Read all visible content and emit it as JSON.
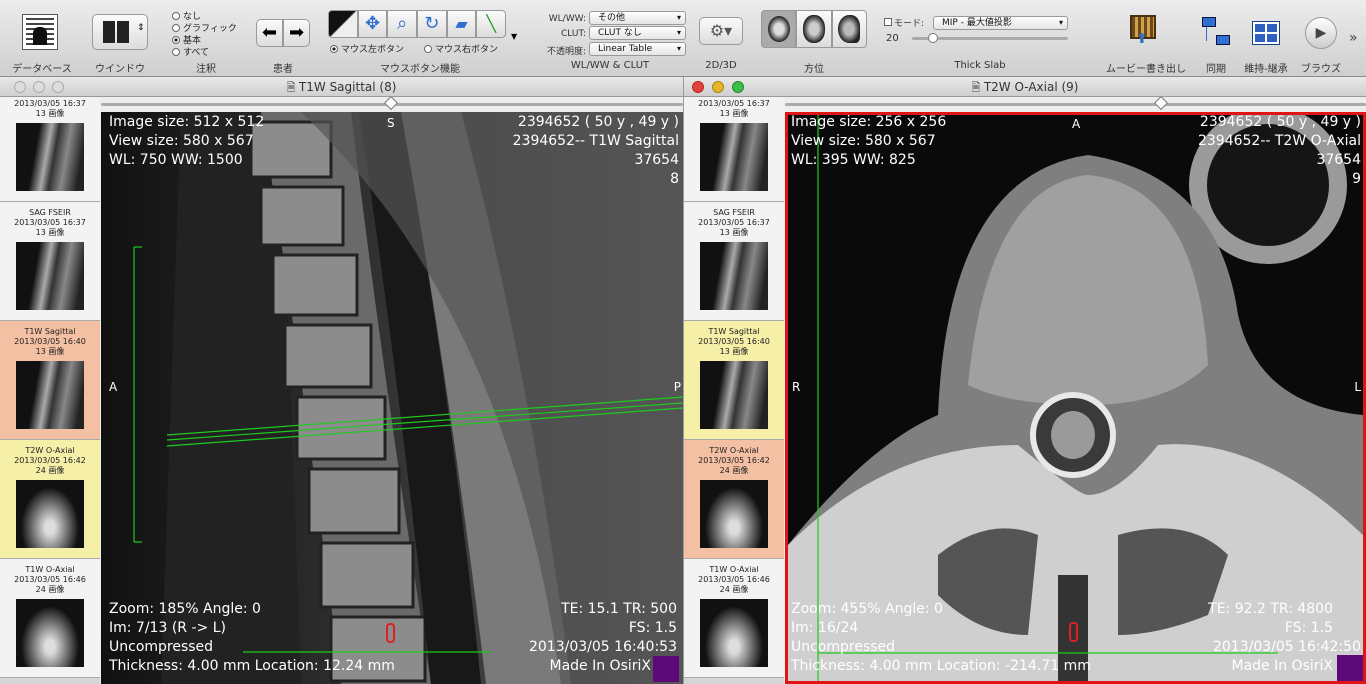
{
  "toolbar": {
    "database": "データベース",
    "window": "ウインドウ",
    "annotation": "注釈",
    "patient": "患者",
    "mouse_func": "マウスボタン機能",
    "wlww_clut": "WL/WW & CLUT",
    "d23": "2D/3D",
    "orientation": "方位",
    "thick_slab": "Thick Slab",
    "movie": "ムービー書き出し",
    "sync": "同期",
    "keep": "維持-継承",
    "browse": "ブラウズ",
    "annot_options": [
      "なし",
      "グラフィック",
      "基本",
      "すべて"
    ],
    "annot_selected": "基本",
    "mouse_left": "マウス左ボタン",
    "mouse_right": "マウス右ボタン",
    "wlww_label": "WL/WW:",
    "wlww_value": "その他",
    "clut_label": "CLUT:",
    "clut_value": "CLUT なし",
    "opacity_label": "不透明度:",
    "opacity_value": "Linear Table",
    "mode_label": "モード:",
    "mode_value": "MIP - 最大値投影",
    "slab_value": "20",
    "accent": "#2f6fd0"
  },
  "left": {
    "title": "T1W Sagittal (8)",
    "series": [
      {
        "name": "",
        "date": "2013/03/05 16:37",
        "count": "13 画像",
        "state": "normal"
      },
      {
        "name": "SAG FSEIR",
        "date": "2013/03/05 16:37",
        "count": "13 画像",
        "state": "normal"
      },
      {
        "name": "T1W Sagittal",
        "date": "2013/03/05 16:40",
        "count": "13 画像",
        "state": "active"
      },
      {
        "name": "T2W O-Axial",
        "date": "2013/03/05 16:42",
        "count": "24 画像",
        "state": "linked"
      },
      {
        "name": "T1W O-Axial",
        "date": "2013/03/05 16:46",
        "count": "24 画像",
        "state": "normal"
      }
    ],
    "ov": {
      "img": "Image size: 512 x 512",
      "view": "View size: 580 x 567",
      "wl": "WL: 750 WW: 1500",
      "pid": "2394652 ( 50 y , 49 y )",
      "pid2": "2394652-- T1W Sagittal",
      "num": "37654",
      "ser": "8",
      "top": "S",
      "left": "A",
      "right": "P",
      "zoom": "Zoom: 185% Angle: 0",
      "im": "Im: 7/13 (R -> L)",
      "comp": "Uncompressed",
      "thick": "Thickness: 4.00 mm Location: 12.24 mm",
      "te": "TE: 15.1 TR: 500",
      "fs": "FS: 1.5",
      "date": "2013/03/05 16:40:53",
      "made": "Made In OsiriX"
    }
  },
  "right": {
    "title": "T2W O-Axial (9)",
    "series": [
      {
        "name": "",
        "date": "2013/03/05 16:37",
        "count": "13 画像",
        "state": "normal"
      },
      {
        "name": "SAG FSEIR",
        "date": "2013/03/05 16:37",
        "count": "13 画像",
        "state": "normal"
      },
      {
        "name": "T1W Sagittal",
        "date": "2013/03/05 16:40",
        "count": "13 画像",
        "state": "linked"
      },
      {
        "name": "T2W O-Axial",
        "date": "2013/03/05 16:42",
        "count": "24 画像",
        "state": "active"
      },
      {
        "name": "T1W O-Axial",
        "date": "2013/03/05 16:46",
        "count": "24 画像",
        "state": "normal"
      }
    ],
    "ov": {
      "img": "Image size: 256 x 256",
      "view": "View size: 580 x 567",
      "wl": "WL: 395 WW: 825",
      "pid": "2394652 ( 50 y , 49 y )",
      "pid2": "2394652-- T2W O-Axial",
      "num": "37654",
      "ser": "9",
      "top": "A",
      "left": "R",
      "right": "L",
      "zoom": "Zoom: 455% Angle: 0",
      "im": "Im: 16/24",
      "comp": "Uncompressed",
      "thick": "Thickness: 4.00 mm Location: -214.71 mm",
      "te": "TE: 92.2 TR: 4800",
      "fs": "FS: 1.5",
      "date": "2013/03/05 16:42:50",
      "made": "Made In OsiriX"
    }
  }
}
